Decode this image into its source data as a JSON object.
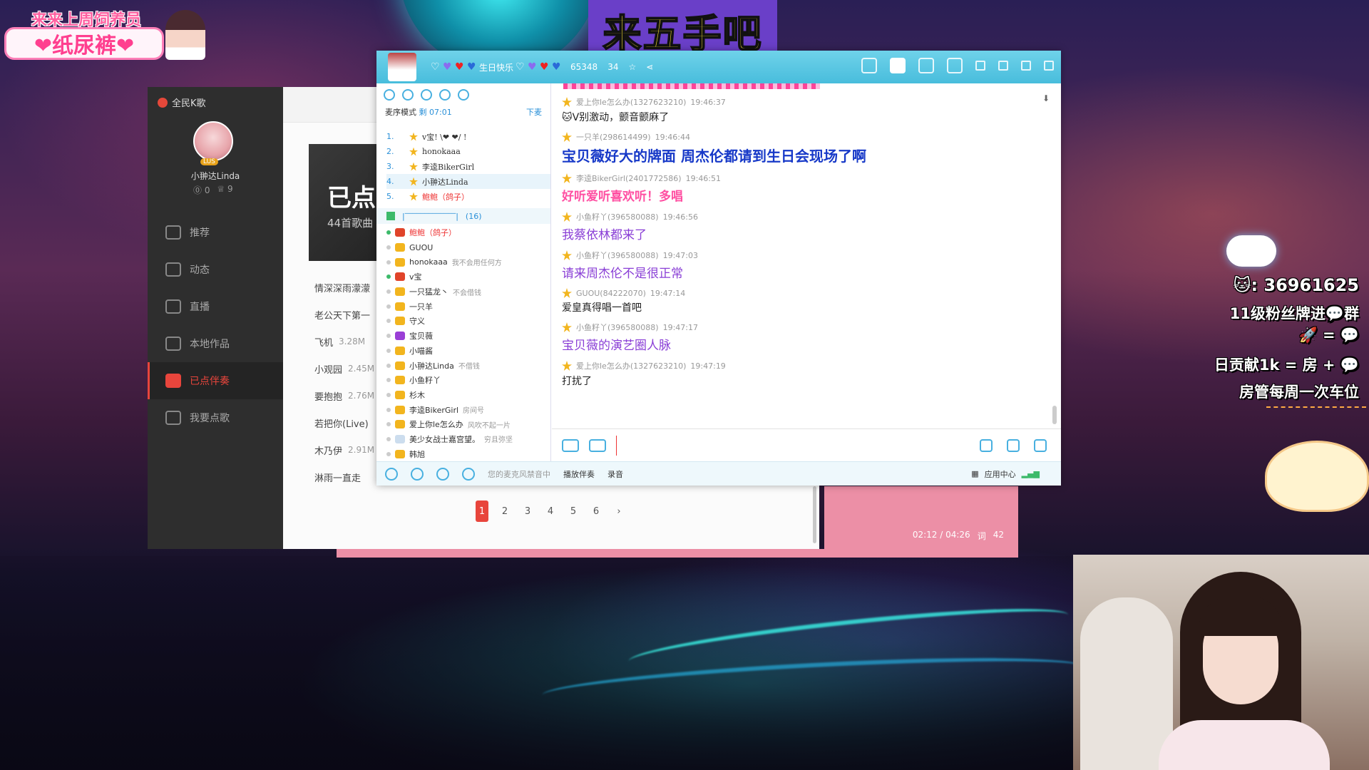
{
  "overlay": {
    "top_sub": "来来上周饲养员",
    "top_main": "❤纸尿裤❤",
    "banner": "来五手吧",
    "right": {
      "l1": "🐱: 36961625",
      "l2": "11级粉丝牌进💬群",
      "l3": "🚀 = 💬",
      "l4": "日贡献1k = 房 + 💬",
      "l5": "房管每周一次车位"
    }
  },
  "karaoke": {
    "brand": "全民K歌",
    "badge": "LUS",
    "username": "小翀达Linda",
    "stats": [
      "⓪ 0",
      "♕ 9"
    ],
    "nav": [
      {
        "label": "推荐",
        "active": false
      },
      {
        "label": "动态",
        "active": false
      },
      {
        "label": "直播",
        "active": false
      },
      {
        "label": "本地作品",
        "active": false
      },
      {
        "label": "已点伴奏",
        "active": true
      },
      {
        "label": "我要点歌",
        "active": false
      }
    ],
    "album_title": "已点",
    "album_count": "44首歌曲",
    "songs": [
      {
        "name": "情深深雨濛濛",
        "size": ""
      },
      {
        "name": "老公天下第一",
        "size": ""
      },
      {
        "name": "飞机",
        "size": "3.28M"
      },
      {
        "name": "小观园",
        "size": "2.45M"
      },
      {
        "name": "要抱抱",
        "size": "2.76M"
      },
      {
        "name": "若把你(Live)",
        "size": ""
      },
      {
        "name": "木乃伊",
        "size": "2.91M"
      },
      {
        "name": "淋雨一直走",
        "size": ""
      }
    ],
    "pages": [
      "1",
      "2",
      "3",
      "4",
      "5",
      "6",
      "›"
    ],
    "player_time": "02:12 / 04:26",
    "player_lyric": "词",
    "player_count": "42"
  },
  "yy": {
    "title_text": "生日快乐",
    "online": "65348",
    "users": "34",
    "mode": "麦序模式",
    "mode_time": "剩 07:01",
    "mode_action": "下麦",
    "queue": [
      {
        "n": "1.",
        "name": "v宝! \\❤ ❤/ !"
      },
      {
        "n": "2.",
        "name": "honokaaa"
      },
      {
        "n": "3.",
        "name": "李逵BikerGirl"
      },
      {
        "n": "4.",
        "name": "小翀达Linda"
      },
      {
        "n": "5.",
        "name": "鲍鲍（鸽子）"
      }
    ],
    "group_title": "|‾‾‾‾‾‾‾‾‾‾‾‾‾|",
    "group_count": "(16)",
    "members": [
      {
        "name": "鲍鲍（鸽子）",
        "note": ""
      },
      {
        "name": "GUOU",
        "note": ""
      },
      {
        "name": "honokaaa",
        "note": "我不会用任何方"
      },
      {
        "name": "v宝",
        "note": ""
      },
      {
        "name": "一只猛龙丶",
        "note": "不会借钱"
      },
      {
        "name": "一只羊",
        "note": ""
      },
      {
        "name": "守义",
        "note": ""
      },
      {
        "name": "宝贝薇",
        "note": ""
      },
      {
        "name": "小喵酱",
        "note": ""
      },
      {
        "name": "小翀达Linda",
        "note": "不借钱"
      },
      {
        "name": "小鱼籽丫",
        "note": ""
      },
      {
        "name": "杉木",
        "note": ""
      },
      {
        "name": "李逵BikerGirl",
        "note": "房间号"
      },
      {
        "name": "爱上你le怎么办",
        "note": "风吹不起一片"
      },
      {
        "name": "美少女战士嘉宫望。",
        "note": "穷且弥坚"
      },
      {
        "name": "韩旭",
        "note": ""
      }
    ],
    "messages": [
      {
        "user": "爱上你le怎么办(1327623210)",
        "time": "19:46:37",
        "text": "🐱V别激动，颤音颤麻了",
        "style": "dark"
      },
      {
        "user": "一只羊(298614499)",
        "time": "19:46:44",
        "text": "宝贝薇好大的牌面 周杰伦都请到生日会现场了啊",
        "style": "blue-big"
      },
      {
        "user": "李逵BikerGirl(2401772586)",
        "time": "19:46:51",
        "text": "好听爱听喜欢听！多唱",
        "style": "pink"
      },
      {
        "user": "小鱼籽丫(396580088)",
        "time": "19:46:56",
        "text": "我蔡依林都来了",
        "style": "purple"
      },
      {
        "user": "小鱼籽丫(396580088)",
        "time": "19:47:03",
        "text": "请来周杰伦不是很正常",
        "style": "purple"
      },
      {
        "user": "GUOU(84222070)",
        "time": "19:47:14",
        "text": "爱皇真得唱一首吧",
        "style": "dark"
      },
      {
        "user": "小鱼籽丫(396580088)",
        "time": "19:47:17",
        "text": "宝贝薇的演艺圈人脉",
        "style": "purple"
      },
      {
        "user": "爱上你le怎么办(1327623210)",
        "time": "19:47:19",
        "text": "打扰了",
        "style": "dark"
      }
    ],
    "input_value": "",
    "bottom": {
      "mute": "您的麦克风禁音中",
      "music": "播放伴奏",
      "record": "录音",
      "apps": "应用中心"
    }
  }
}
